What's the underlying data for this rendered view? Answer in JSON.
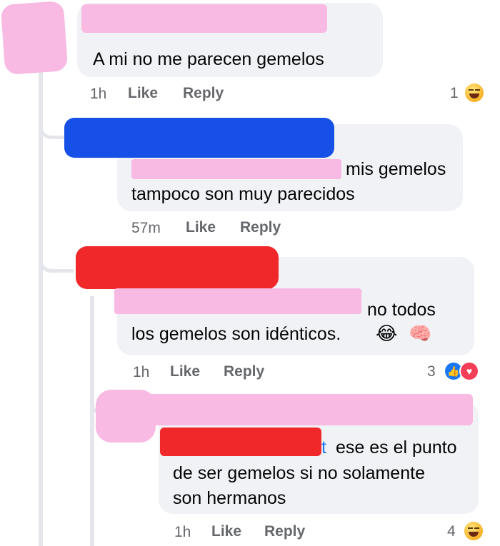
{
  "comments": [
    {
      "text": [
        "A mi no me parecen gemelos"
      ],
      "time": "1h",
      "like": "Like",
      "reply": "Reply",
      "count": "1",
      "reaction": "laugh-emoji"
    },
    {
      "text": [
        "mis gemelos",
        "tampoco son muy parecidos"
      ],
      "time": "57m",
      "like": "Like",
      "reply": "Reply"
    },
    {
      "text": [
        "no todos",
        "los gemelos son idénticos."
      ],
      "time": "1h",
      "like": "Like",
      "reply": "Reply",
      "count": "3",
      "reaction": "like-love",
      "inline_emojis": [
        "😂",
        "🧠"
      ]
    },
    {
      "mention_end": "t",
      "text": [
        "ese es el punto",
        "de ser gemelos si no solamente",
        "son hermanos"
      ],
      "time": "1h",
      "like": "Like",
      "reply": "Reply",
      "count": "4",
      "reaction": "laugh-emoji"
    }
  ],
  "colors": {
    "bubble": "#f0f2f5",
    "meta": "#65676b",
    "mention": "#1877f2",
    "pink_redact": "#f8b9e3",
    "blue_redact": "#1650e6",
    "red_redact": "#f0282a"
  }
}
